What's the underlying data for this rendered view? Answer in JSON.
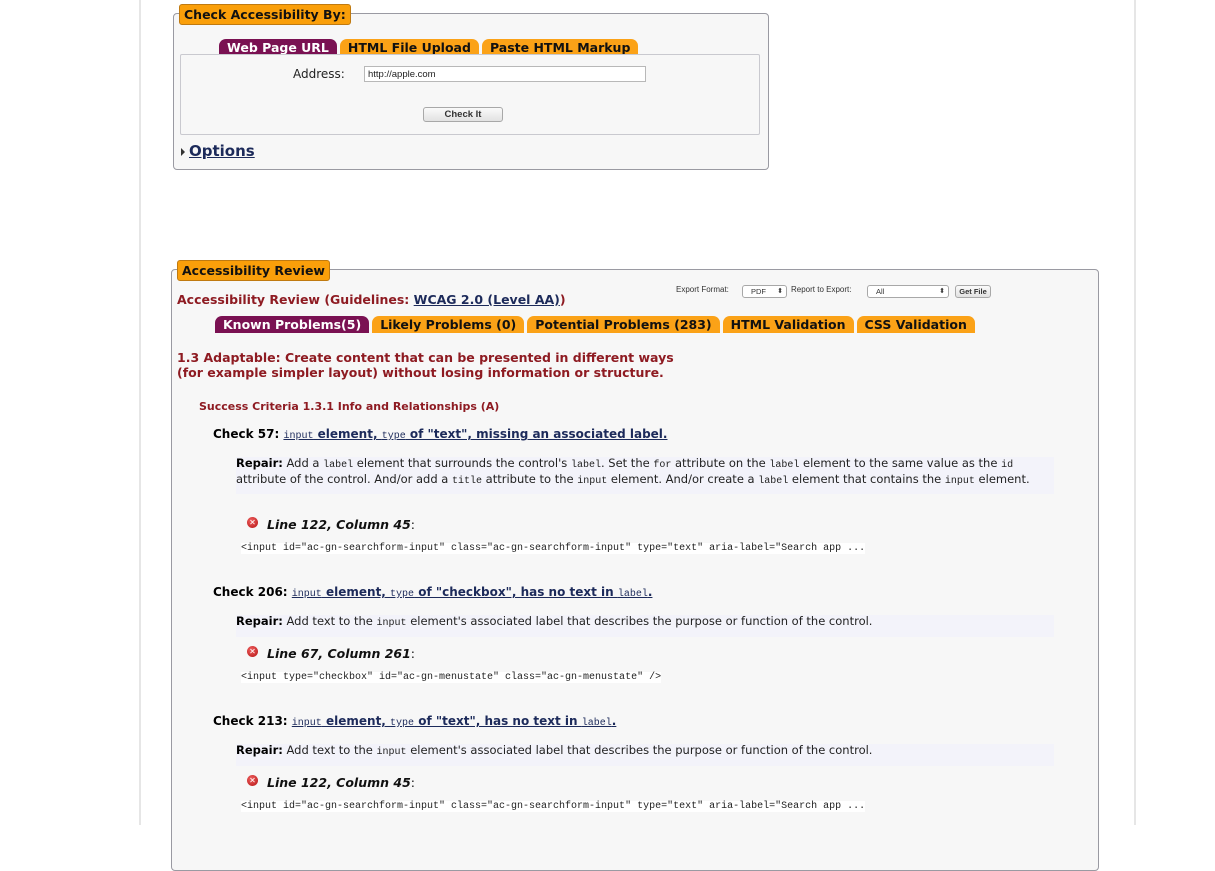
{
  "check_form": {
    "legend": "Check Accessibility By:",
    "tabs": [
      {
        "label": "Web Page URL",
        "active": true
      },
      {
        "label": "HTML File Upload",
        "active": false
      },
      {
        "label": "Paste HTML Markup",
        "active": false
      }
    ],
    "address_label": "Address:",
    "address_value": "http://apple.com",
    "submit_label": "Check It",
    "options_label": "Options"
  },
  "review": {
    "legend": "Accessibility Review",
    "heading_prefix": "Accessibility Review (Guidelines: ",
    "heading_link": "WCAG 2.0 (Level AA)",
    "heading_suffix": ")",
    "export": {
      "format_label": "Export Format:",
      "format_value": "PDF",
      "report_label": "Report to Export:",
      "report_value": "All",
      "get_file_label": "Get File"
    },
    "tabs": [
      {
        "label": "Known Problems(5)",
        "active": true
      },
      {
        "label": "Likely Problems (0)",
        "active": false
      },
      {
        "label": "Potential Problems (283)",
        "active": false
      },
      {
        "label": "HTML Validation",
        "active": false
      },
      {
        "label": "CSS Validation",
        "active": false
      }
    ],
    "guideline": "1.3 Adaptable: Create content that can be presented in different ways (for example simpler layout) without losing information or structure.",
    "success_criteria": "Success Criteria 1.3.1 Info and Relationships (A)",
    "checks": [
      {
        "number": "Check 57:",
        "title_parts": [
          "input",
          " element, ",
          "type",
          " of \"text\", missing an associated label."
        ],
        "repair_label": "Repair:",
        "repair_parts": [
          "Add a ",
          "label",
          " element that surrounds the control's ",
          "label",
          ". Set the ",
          "for",
          " attribute on the ",
          "label",
          " element to the same value as the ",
          "id",
          " attribute of the control. And/or add a ",
          "title",
          " attribute to the ",
          "input",
          " element. And/or create a ",
          "label",
          " element that contains the ",
          "input",
          " element."
        ],
        "location": "Line 122, Column 45",
        "code": "<input id=\"ac-gn-searchform-input\" class=\"ac-gn-searchform-input\" type=\"text\" aria-label=\"Search app ..."
      },
      {
        "number": "Check 206:",
        "title_parts": [
          "input",
          " element, ",
          "type",
          " of \"checkbox\", has no text in ",
          "label",
          "."
        ],
        "repair_label": "Repair:",
        "repair_parts": [
          "Add text to the ",
          "input",
          " element's associated label that describes the purpose or function of the control."
        ],
        "location": "Line 67, Column 261",
        "code": "<input type=\"checkbox\" id=\"ac-gn-menustate\" class=\"ac-gn-menustate\" />"
      },
      {
        "number": "Check 213:",
        "title_parts": [
          "input",
          " element, ",
          "type",
          " of \"text\", has no text in ",
          "label",
          "."
        ],
        "repair_label": "Repair:",
        "repair_parts": [
          "Add text to the ",
          "input",
          " element's associated label that describes the purpose or function of the control."
        ],
        "location": "Line 122, Column 45",
        "code": "<input id=\"ac-gn-searchform-input\" class=\"ac-gn-searchform-input\" type=\"text\" aria-label=\"Search app ..."
      }
    ]
  },
  "colors": {
    "tab_orange": "#fba217",
    "tab_active": "#7a1152",
    "heading_maroon": "#8e1b22",
    "link_navy": "#1c2a5a",
    "error_red": "#c41a1a"
  }
}
